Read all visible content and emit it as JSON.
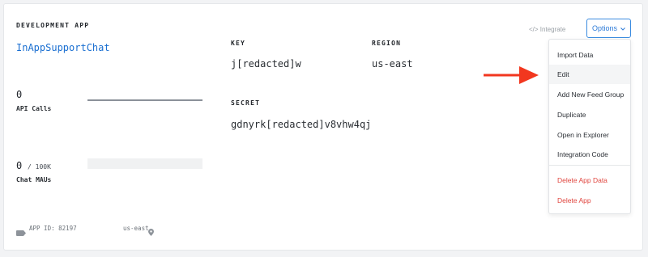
{
  "app": {
    "section_label": "DEVELOPMENT APP",
    "name": "InAppSupportChat"
  },
  "stats": {
    "api_calls": {
      "value": "0",
      "label": "API Calls"
    },
    "chat_maus": {
      "value": "0",
      "limit": "/ 100K",
      "label": "Chat MAUs"
    }
  },
  "credentials": {
    "key_label": "KEY",
    "key_value": "j[redacted]w",
    "region_label": "REGION",
    "region_value": "us-east",
    "secret_label": "SECRET",
    "secret_value": "gdnyrk[redacted]v8vhw4qj"
  },
  "footer": {
    "app_id": "APP ID: 82197",
    "region": "us-east"
  },
  "toolbar": {
    "integrate_label": "</> Integrate",
    "options_label": "Options"
  },
  "menu": {
    "items": [
      {
        "label": "Import Data"
      },
      {
        "label": "Edit"
      },
      {
        "label": "Add New Feed Group"
      },
      {
        "label": "Duplicate"
      },
      {
        "label": "Open in Explorer"
      },
      {
        "label": "Integration Code"
      },
      {
        "label": "Delete App Data"
      },
      {
        "label": "Delete App"
      }
    ]
  },
  "colors": {
    "accent": "#2d7bd8",
    "link": "#1a6fd1",
    "danger": "#e0453e",
    "arrow": "#f2371f"
  }
}
